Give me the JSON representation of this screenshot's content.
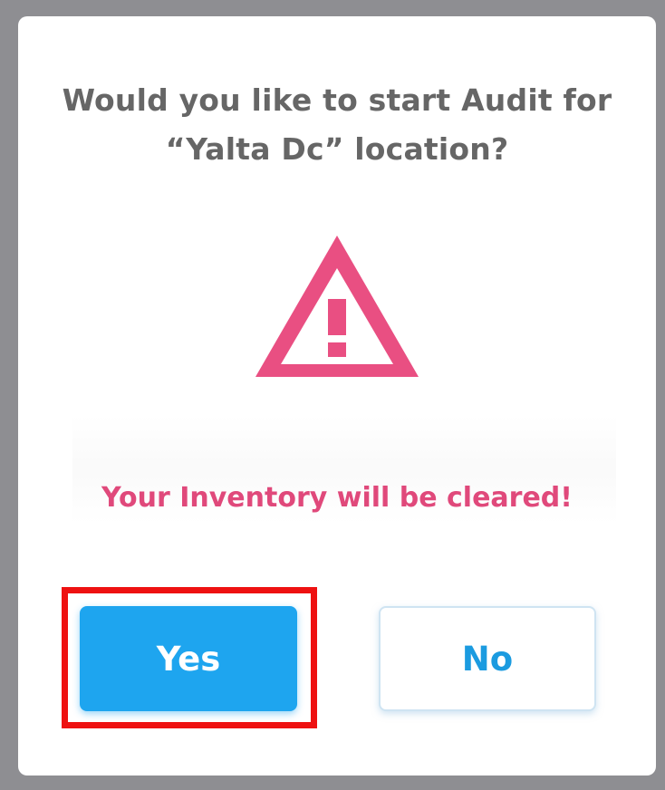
{
  "dialog": {
    "question_line1": "Would you like to start Audit for",
    "question_line2": "“Yalta Dc” location?",
    "icon": "warning-triangle-icon",
    "warning_text": "Your Inventory will be cleared!",
    "yes_label": "Yes",
    "no_label": "No"
  },
  "colors": {
    "accent": "#1ea5ef",
    "warning": "#e0497b",
    "highlight_box": "#ee1111",
    "backdrop": "#8e8e92"
  }
}
